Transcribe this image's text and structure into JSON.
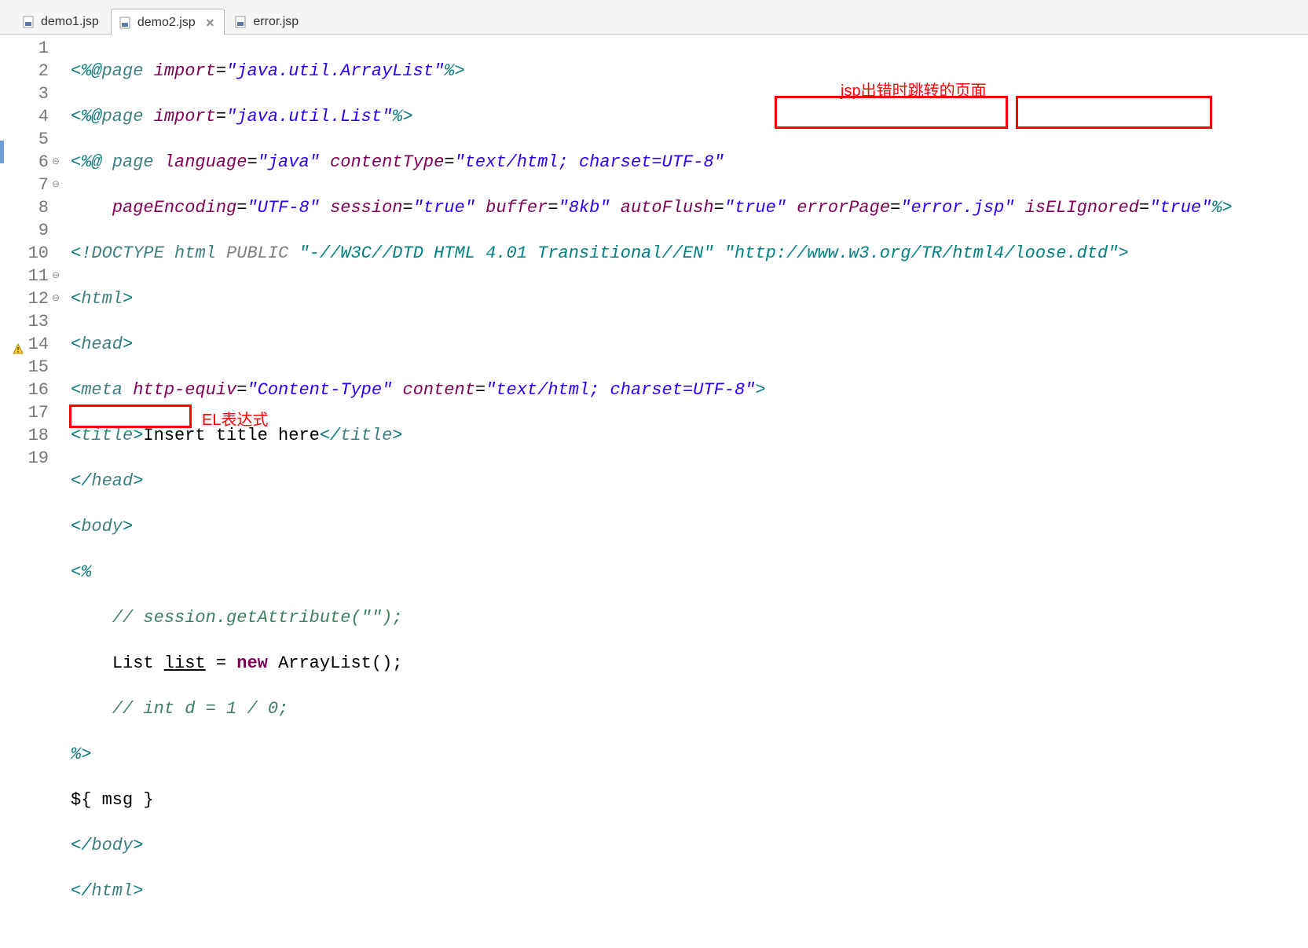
{
  "tabs": [
    {
      "label": "demo1.jsp",
      "active": false,
      "closable": false
    },
    {
      "label": "demo2.jsp",
      "active": true,
      "closable": true
    },
    {
      "label": "error.jsp",
      "active": false,
      "closable": false
    }
  ],
  "line_numbers": [
    "1",
    "2",
    "3",
    "4",
    "5",
    "6",
    "7",
    "8",
    "9",
    "10",
    "11",
    "12",
    "13",
    "14",
    "15",
    "16",
    "17",
    "18",
    "19"
  ],
  "fold_markers": {
    "6": "⊖",
    "7": "⊖",
    "11": "⊖",
    "12": "⊖"
  },
  "warning_line": 14,
  "annotations": {
    "top_label": "jsp出错时跳转的页面",
    "el_label": "EL表达式"
  },
  "code": {
    "l1": {
      "open": "<%@",
      "dir": "page ",
      "a1": "import",
      "eq": "=",
      "v1": "\"java.util.ArrayList\"",
      "close": "%>"
    },
    "l2": {
      "open": "<%@",
      "dir": "page ",
      "a1": "import",
      "eq": "=",
      "v1": "\"java.util.List\"",
      "close": "%>"
    },
    "l3": {
      "open": "<%@",
      "sp": " ",
      "dir": "page ",
      "a1": "language",
      "v1": "\"java\"",
      "a2": "contentType",
      "v2": "\"text/html; charset=UTF-8\""
    },
    "l4": {
      "indent": "    ",
      "a1": "pageEncoding",
      "v1": "\"UTF-8\"",
      "a2": "session",
      "v2": "\"true\"",
      "a3": "buffer",
      "v3": "\"8kb\"",
      "a4": "autoFlush",
      "v4": "\"true\"",
      "a5": "errorPage",
      "v5": "\"error.jsp\"",
      "a6": "isELIgnored",
      "v6": "\"true\"",
      "close": "%>"
    },
    "l5": {
      "open": "<!",
      "kw": "DOCTYPE ",
      "root": "html ",
      "pub": "PUBLIC ",
      "fpi": "\"-//W3C//DTD HTML 4.01 Transitional//EN\" ",
      "uri": "\"http://www.w3.org/TR/html4/loose.dtd\"",
      "close": ">"
    },
    "l6": {
      "open": "<",
      "name": "html",
      "close": ">"
    },
    "l7": {
      "open": "<",
      "name": "head",
      "close": ">"
    },
    "l8": {
      "open": "<",
      "name": "meta ",
      "a1": "http-equiv",
      "v1": "\"Content-Type\"",
      "a2": "content",
      "v2": "\"text/html; charset=UTF-8\"",
      "close": ">"
    },
    "l9": {
      "open": "<",
      "name": "title",
      "close": ">",
      "text": "Insert title here",
      "open2": "</",
      "name2": "title",
      "close2": ">"
    },
    "l10": {
      "open": "</",
      "name": "head",
      "close": ">"
    },
    "l11": {
      "open": "<",
      "name": "body",
      "close": ">"
    },
    "l12": {
      "scr": "<%"
    },
    "l13": {
      "indent": "    ",
      "c": "// session.getAttribute(\"\");"
    },
    "l14": {
      "indent": "    ",
      "t1": "List",
      "sp1": " ",
      "id": "list",
      "sp2": " = ",
      "kw": "new",
      "sp3": " ",
      "t2": "ArrayList",
      "tail": "();"
    },
    "l15": {
      "indent": "    ",
      "c": "// int d = 1 / 0;"
    },
    "l16": {
      "scr": "%>"
    },
    "l17": {
      "el": "${ msg }"
    },
    "l18": {
      "open": "</",
      "name": "body",
      "close": ">"
    },
    "l19": {
      "open": "</",
      "name": "html",
      "close": ">"
    }
  }
}
